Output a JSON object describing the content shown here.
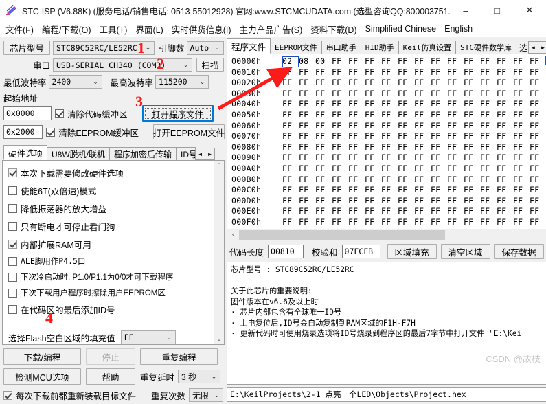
{
  "window": {
    "title": "STC-ISP (V6.88K) (服务电话/销售电话: 0513-55012928) 官网:www.STCMCUDATA.com  (选型咨询QQ:800003751...",
    "minimize": "–",
    "maximize": "□",
    "close": "✕"
  },
  "menu": [
    {
      "label": "文件(F)"
    },
    {
      "label": "编程/下载(O)"
    },
    {
      "label": "工具(T)"
    },
    {
      "label": "界面(L)"
    },
    {
      "label": "实时供货信息(I)"
    },
    {
      "label": "主力产品广告(S)"
    },
    {
      "label": "资料下载(D)"
    },
    {
      "label": "Simplified Chinese"
    },
    {
      "label": "English"
    }
  ],
  "left": {
    "chip_model_label": "芯片型号",
    "chip_model_value": "STC89C52RC/LE52RC",
    "pin_count_label": "引脚数",
    "pin_count_value": "Auto",
    "serial_port_label": "串口",
    "serial_port_value": "USB-SERIAL CH340 (COM3)",
    "scan_button": "扫描",
    "min_baud_label": "最低波特率",
    "min_baud_value": "2400",
    "max_baud_label": "最高波特率",
    "max_baud_value": "115200",
    "start_address_label": "起始地址",
    "code_addr_value": "0x0000",
    "clear_code_buffer": "清除代码缓冲区",
    "eeprom_addr_value": "0x2000",
    "clear_eeprom_buffer": "清除EEPROM缓冲区",
    "open_program_file": "打开程序文件",
    "open_eeprom_file": "打开EEPROM文件",
    "tabs": [
      {
        "label": "硬件选项",
        "active": true
      },
      {
        "label": "U8W脱机/联机",
        "active": false
      },
      {
        "label": "程序加密后传输",
        "active": false
      },
      {
        "label": "ID号",
        "active": false
      }
    ],
    "tab_scroll_left": "◄",
    "tab_scroll_right": "►",
    "options": [
      {
        "label": "本次下载需要修改硬件选项",
        "checked": true,
        "dim": true
      },
      {
        "label": "使能6T(双倍速)模式",
        "checked": false,
        "dim": false
      },
      {
        "label": "降低振荡器的放大增益",
        "checked": false,
        "dim": false
      },
      {
        "label": "只有断电才可停止看门狗",
        "checked": false,
        "dim": false
      },
      {
        "label": "内部扩展RAM可用",
        "checked": true,
        "dim": true
      },
      {
        "label": "ALE脚用作P4.5口",
        "checked": false,
        "dim": false
      },
      {
        "label": "下次冷启动时, P1.0/P1.1为0/0才可下载程序",
        "checked": false,
        "dim": false
      },
      {
        "label": "下次下载用户程序时擦除用户EEPROM区",
        "checked": false,
        "dim": false
      },
      {
        "label": "在代码区的最后添加ID号",
        "checked": false,
        "dim": false
      }
    ],
    "flash_fill_label": "选择Flash空白区域的填充值",
    "flash_fill_value": "FF",
    "download_button": "下载/编程",
    "stop_button": "停止",
    "repeat_program_button": "重复编程",
    "detect_mcu_button": "检测MCU选项",
    "help_button": "帮助",
    "repeat_delay_label": "重复延时",
    "repeat_delay_value": "3 秒",
    "repeat_count_label": "重复次数",
    "repeat_count_value": "无限",
    "reload_label": "每次下载前都重新装载目标文件",
    "reload_checked": true
  },
  "right": {
    "tabs": [
      {
        "label": "程序文件",
        "active": true
      },
      {
        "label": "EEPROM文件",
        "active": false
      },
      {
        "label": "串口助手",
        "active": false
      },
      {
        "label": "HID助手",
        "active": false
      },
      {
        "label": "Keil仿真设置",
        "active": false
      },
      {
        "label": "STC硬件数学库",
        "active": false
      },
      {
        "label": "选",
        "active": false
      }
    ],
    "tab_scroll_left": "◄",
    "tab_scroll_right": "►",
    "hex_rows": [
      {
        "addr": "00000h",
        "bytes": [
          "02",
          "08",
          "00",
          "FF",
          "FF",
          "FF",
          "FF",
          "FF",
          "FF",
          "FF",
          "FF",
          "FF",
          "FF",
          "FF",
          "FF",
          "FF"
        ]
      },
      {
        "addr": "00010h",
        "bytes": [
          "FF",
          "FF",
          "FF",
          "FF",
          "FF",
          "FF",
          "FF",
          "FF",
          "FF",
          "FF",
          "FF",
          "FF",
          "FF",
          "FF",
          "FF",
          "FF"
        ]
      },
      {
        "addr": "00020h",
        "bytes": [
          "FF",
          "FF",
          "FF",
          "FF",
          "FF",
          "FF",
          "FF",
          "FF",
          "FF",
          "FF",
          "FF",
          "FF",
          "FF",
          "FF",
          "FF",
          "FF"
        ]
      },
      {
        "addr": "00030h",
        "bytes": [
          "FF",
          "FF",
          "FF",
          "FF",
          "FF",
          "FF",
          "FF",
          "FF",
          "FF",
          "FF",
          "FF",
          "FF",
          "FF",
          "FF",
          "FF",
          "FF"
        ]
      },
      {
        "addr": "00040h",
        "bytes": [
          "FF",
          "FF",
          "FF",
          "FF",
          "FF",
          "FF",
          "FF",
          "FF",
          "FF",
          "FF",
          "FF",
          "FF",
          "FF",
          "FF",
          "FF",
          "FF"
        ]
      },
      {
        "addr": "00050h",
        "bytes": [
          "FF",
          "FF",
          "FF",
          "FF",
          "FF",
          "FF",
          "FF",
          "FF",
          "FF",
          "FF",
          "FF",
          "FF",
          "FF",
          "FF",
          "FF",
          "FF"
        ]
      },
      {
        "addr": "00060h",
        "bytes": [
          "FF",
          "FF",
          "FF",
          "FF",
          "FF",
          "FF",
          "FF",
          "FF",
          "FF",
          "FF",
          "FF",
          "FF",
          "FF",
          "FF",
          "FF",
          "FF"
        ]
      },
      {
        "addr": "00070h",
        "bytes": [
          "FF",
          "FF",
          "FF",
          "FF",
          "FF",
          "FF",
          "FF",
          "FF",
          "FF",
          "FF",
          "FF",
          "FF",
          "FF",
          "FF",
          "FF",
          "FF"
        ]
      },
      {
        "addr": "00080h",
        "bytes": [
          "FF",
          "FF",
          "FF",
          "FF",
          "FF",
          "FF",
          "FF",
          "FF",
          "FF",
          "FF",
          "FF",
          "FF",
          "FF",
          "FF",
          "FF",
          "FF"
        ]
      },
      {
        "addr": "00090h",
        "bytes": [
          "FF",
          "FF",
          "FF",
          "FF",
          "FF",
          "FF",
          "FF",
          "FF",
          "FF",
          "FF",
          "FF",
          "FF",
          "FF",
          "FF",
          "FF",
          "FF"
        ]
      },
      {
        "addr": "000A0h",
        "bytes": [
          "FF",
          "FF",
          "FF",
          "FF",
          "FF",
          "FF",
          "FF",
          "FF",
          "FF",
          "FF",
          "FF",
          "FF",
          "FF",
          "FF",
          "FF",
          "FF"
        ]
      },
      {
        "addr": "000B0h",
        "bytes": [
          "FF",
          "FF",
          "FF",
          "FF",
          "FF",
          "FF",
          "FF",
          "FF",
          "FF",
          "FF",
          "FF",
          "FF",
          "FF",
          "FF",
          "FF",
          "FF"
        ]
      },
      {
        "addr": "000C0h",
        "bytes": [
          "FF",
          "FF",
          "FF",
          "FF",
          "FF",
          "FF",
          "FF",
          "FF",
          "FF",
          "FF",
          "FF",
          "FF",
          "FF",
          "FF",
          "FF",
          "FF"
        ]
      },
      {
        "addr": "000D0h",
        "bytes": [
          "FF",
          "FF",
          "FF",
          "FF",
          "FF",
          "FF",
          "FF",
          "FF",
          "FF",
          "FF",
          "FF",
          "FF",
          "FF",
          "FF",
          "FF",
          "FF"
        ]
      },
      {
        "addr": "000E0h",
        "bytes": [
          "FF",
          "FF",
          "FF",
          "FF",
          "FF",
          "FF",
          "FF",
          "FF",
          "FF",
          "FF",
          "FF",
          "FF",
          "FF",
          "FF",
          "FF",
          "FF"
        ]
      },
      {
        "addr": "000F0h",
        "bytes": [
          "FF",
          "FF",
          "FF",
          "FF",
          "FF",
          "FF",
          "FF",
          "FF",
          "FF",
          "FF",
          "FF",
          "FF",
          "FF",
          "FF",
          "FF",
          "FF"
        ]
      }
    ],
    "code_length_label": "代码长度",
    "code_length_value": "00810",
    "checksum_label": "校验和",
    "checksum_value": "07FCFB",
    "fill_region_button": "区域填充",
    "clear_region_button": "清空区域",
    "save_data_button": "保存数据",
    "info_lines": [
      "芯片型号 : STC89C52RC/LE52RC",
      "",
      "关于此芯片的重要说明:",
      "  固件版本在v6.6及以上时",
      "    · 芯片内部包含有全球唯一ID号",
      "    · 上电复位后,ID号会自动复制到RAM区域的F1H-F7H",
      "    · 更新代码时可使用烧录选项将ID号烧录到程序区的最后7字节中打开文件 \"E:\\Kei"
    ],
    "file_path": "E:\\KeilProjects\\2-1 点亮一个LED\\Objects\\Project.hex"
  },
  "annotations": [
    {
      "id": "1",
      "text": "1"
    },
    {
      "id": "2",
      "text": "2"
    },
    {
      "id": "3",
      "text": "3"
    },
    {
      "id": "4",
      "text": "4"
    }
  ],
  "watermark": "CSDN @故枝",
  "colors": {
    "annotation_red": "#ff1a1a",
    "focus_blue": "#0078d7",
    "active_tab": "#ffffff",
    "window_bg": "#f0f0f0"
  }
}
